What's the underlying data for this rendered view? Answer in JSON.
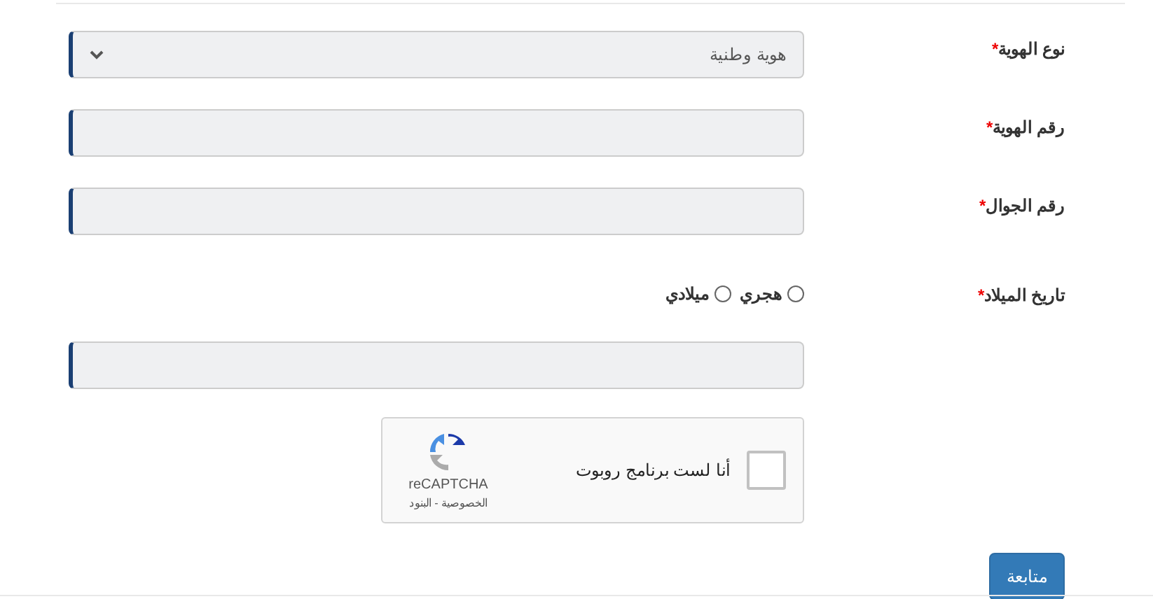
{
  "fields": [
    {
      "kind": "select",
      "label": "نوع الهوية",
      "required_mark": "*",
      "value": "هوية وطنية"
    },
    {
      "kind": "input",
      "label": "رقم الهوية",
      "required_mark": "*"
    },
    {
      "kind": "input",
      "label": "رقم الجوال",
      "required_mark": "*"
    },
    {
      "kind": "date",
      "label": "تاريخ الميلاد",
      "required_mark": "*",
      "options": [
        {
          "label": "هجري",
          "selected": false
        },
        {
          "label": "ميلادي",
          "selected": false
        }
      ]
    }
  ],
  "captcha": {
    "checked": false,
    "text": "أنا لست برنامج روبوت",
    "brand": "reCAPTCHA",
    "links": "الخصوصية - البنود"
  },
  "submit": "متابعة"
}
